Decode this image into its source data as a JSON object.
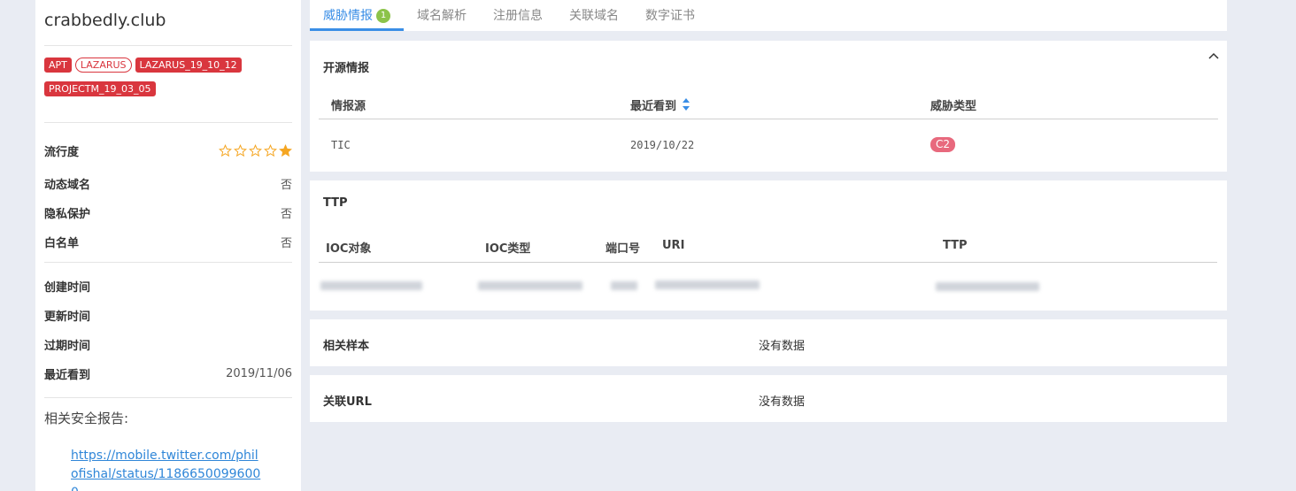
{
  "sidebar": {
    "domain": "crabbedly.club",
    "tags": [
      {
        "label": "APT",
        "style": "solid"
      },
      {
        "label": "LAZARUS",
        "style": "outline"
      },
      {
        "label": "LAZARUS_19_10_12",
        "style": "solid"
      },
      {
        "label": "PROJECTM_19_03_05",
        "style": "solid"
      }
    ],
    "popularity_label": "流行度",
    "popularity_stars": 1,
    "popularity_max": 5,
    "dynamic_domain_label": "动态域名",
    "dynamic_domain_value": "否",
    "privacy_label": "隐私保护",
    "privacy_value": "否",
    "whitelist_label": "白名单",
    "whitelist_value": "否",
    "created_label": "创建时间",
    "updated_label": "更新时间",
    "expire_label": "过期时间",
    "last_seen_label": "最近看到",
    "last_seen_value": "2019/11/06",
    "report_title": "相关安全报告:",
    "report_link": "https://mobile.twitter.com/philofishal/status/11866500996000..."
  },
  "tabs": [
    {
      "label": "威胁情报",
      "badge": "1",
      "active": true
    },
    {
      "label": "域名解析"
    },
    {
      "label": "注册信息"
    },
    {
      "label": "关联域名"
    },
    {
      "label": "数字证书"
    }
  ],
  "open_source": {
    "title": "开源情报",
    "headers": [
      "情报源",
      "最近看到",
      "威胁类型"
    ],
    "rows": [
      {
        "source": "TIC",
        "last_seen": "2019/10/22",
        "type": "C2"
      }
    ]
  },
  "ttp": {
    "title": "TTP",
    "headers": [
      "IOC对象",
      "IOC类型",
      "端口号",
      "URI",
      "TTP"
    ]
  },
  "samples": {
    "title": "相关样本",
    "empty": "没有数据"
  },
  "urls": {
    "title": "关联URL",
    "empty": "没有数据"
  },
  "colors": {
    "accent": "#3a8ee6",
    "tag_red": "#d9363e",
    "c2_pink": "#e8697d",
    "star": "#f5a623",
    "badge_green": "#8cc34a"
  }
}
